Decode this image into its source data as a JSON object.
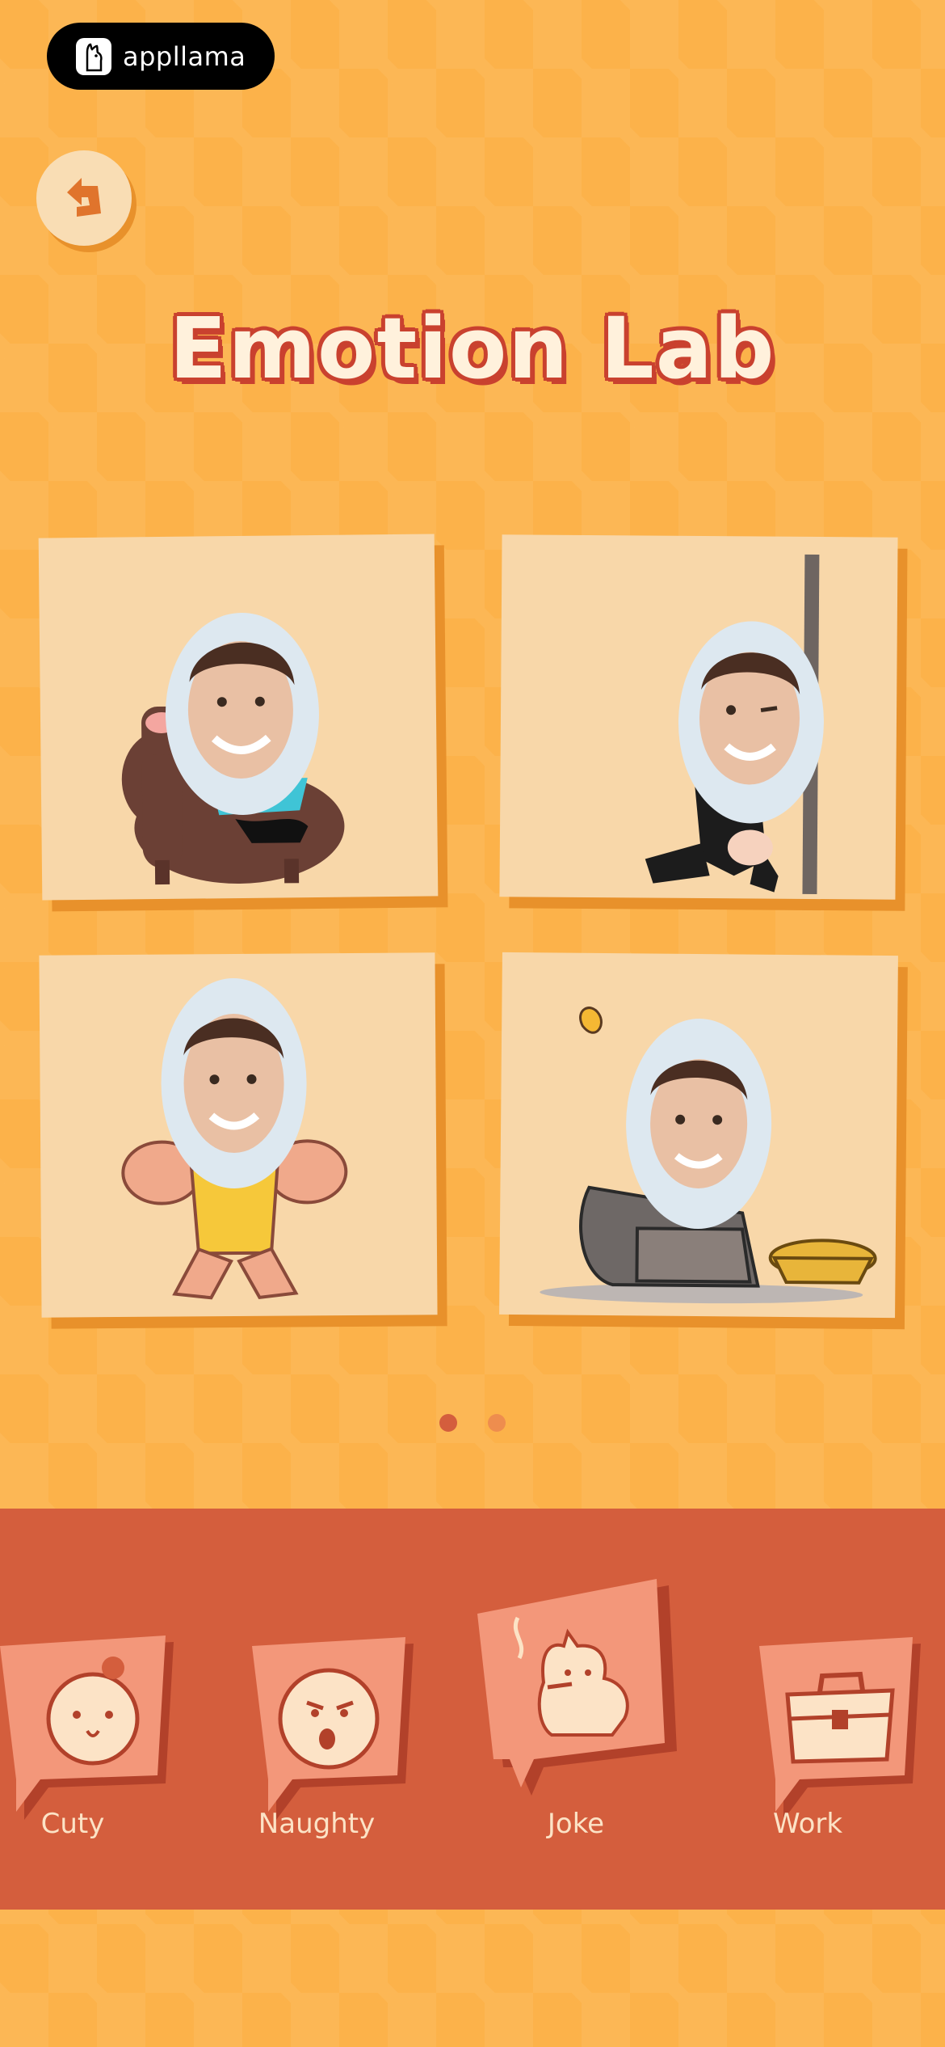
{
  "brand": {
    "name": "appllama",
    "icon": "llama-logo-icon"
  },
  "nav": {
    "back_icon": "back-arrow-icon"
  },
  "page": {
    "title": "Emotion Lab"
  },
  "stickers": [
    {
      "icon": "face-on-llama-sticker"
    },
    {
      "icon": "face-pole-dancer-sticker"
    },
    {
      "icon": "face-bodybuilder-sticker"
    },
    {
      "icon": "face-sad-beggar-sticker"
    }
  ],
  "pager": {
    "total": 2,
    "active": 1
  },
  "categories": [
    {
      "label": "Cuty",
      "icon": "cute-face-icon",
      "selected": false
    },
    {
      "label": "Naughty",
      "icon": "naughty-face-icon",
      "selected": false
    },
    {
      "label": "Joke",
      "icon": "smoking-llama-icon",
      "selected": true
    },
    {
      "label": "Work",
      "icon": "briefcase-icon",
      "selected": false
    }
  ],
  "colors": {
    "background": "#FCB24A",
    "card": "#F8D7A9",
    "card_shadow": "#E8912B",
    "category_bar": "#D45E3D",
    "title_outline": "#C9412F",
    "dot_active": "#D45E3D",
    "dot_inactive": "#EE8D4E"
  }
}
